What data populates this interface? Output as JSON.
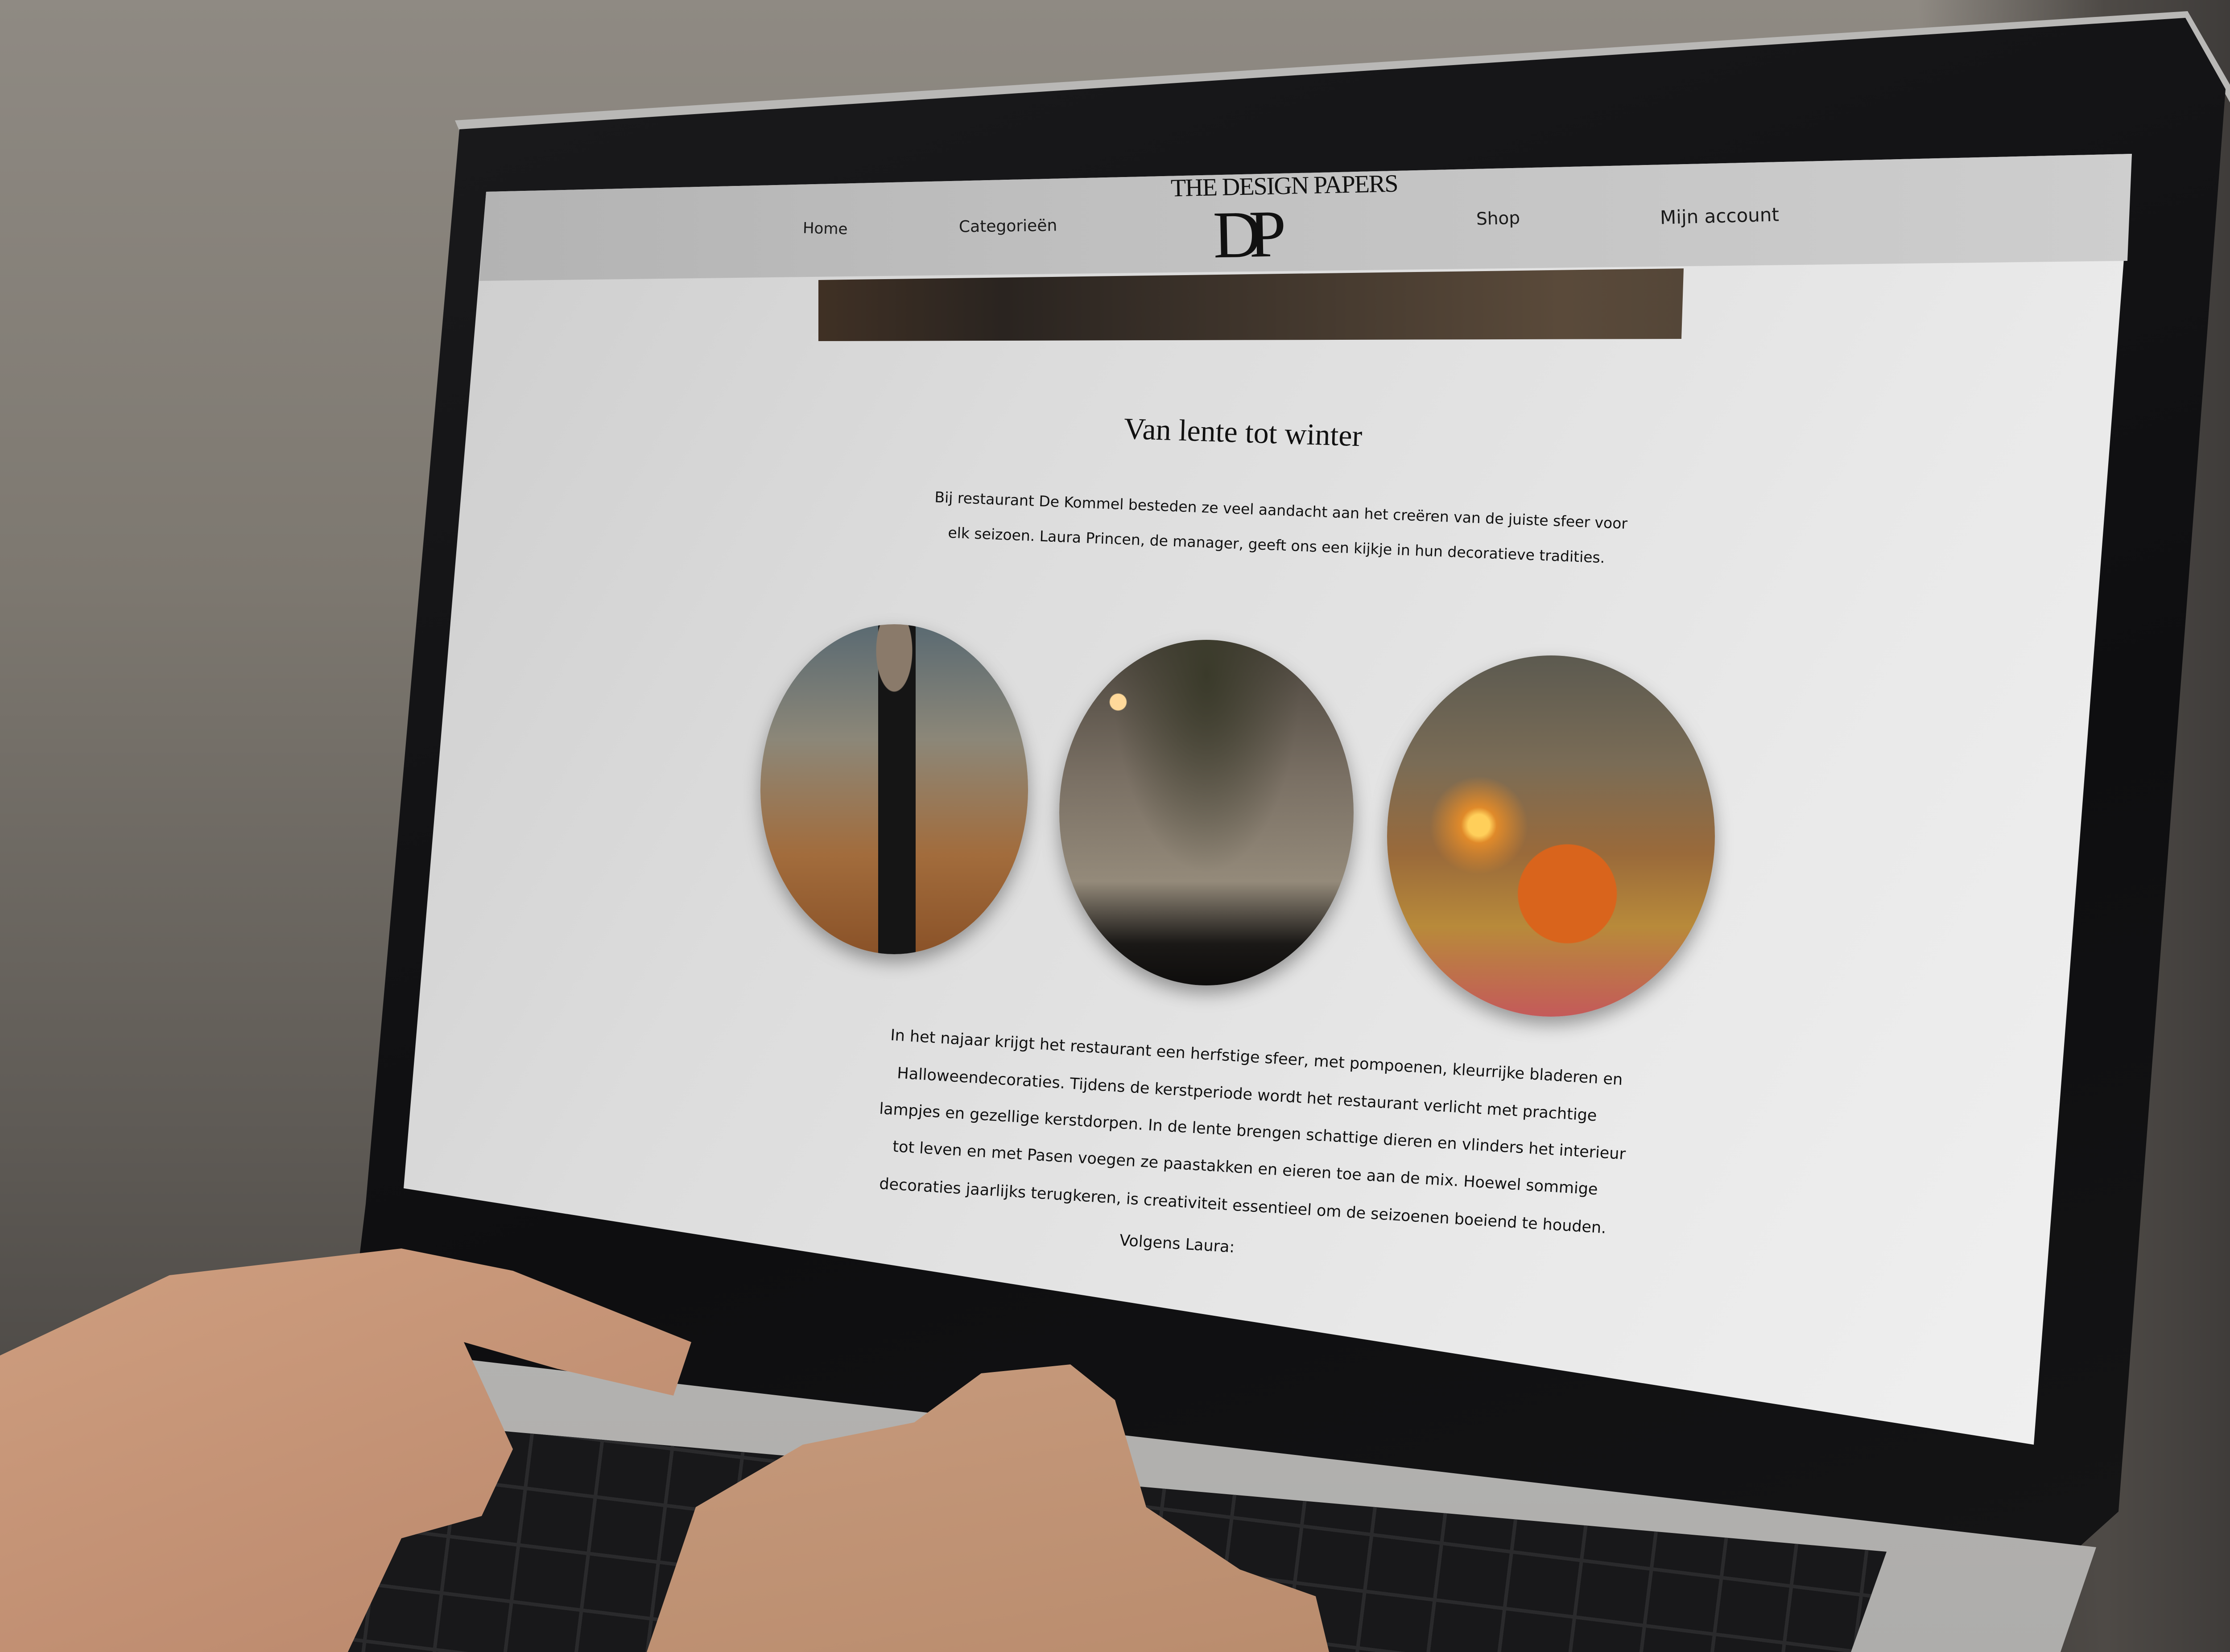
{
  "nav": {
    "home": "Home",
    "categories": "Categorieën",
    "shop": "Shop",
    "account": "Mijn account"
  },
  "logo": {
    "wordmark": "THE DESIGN PAPERS",
    "monogram": "DP"
  },
  "article": {
    "title": "Van lente tot winter",
    "intro_lines": [
      "Bij restaurant De Kommel besteden ze veel aandacht aan het creëren van de juiste sfeer voor",
      "elk seizoen. Laura Princen, de manager, geeft ons een kijkje in hun decoratieve tradities."
    ],
    "body_lines": [
      "In het najaar krijgt het restaurant een herfstige sfeer, met pompoenen, kleurrijke bladeren en",
      "Halloweendecoraties. Tijdens de kerstperiode wordt het restaurant verlicht met prachtige",
      "lampjes en gezellige kerstdorpen. In de lente brengen schattige dieren en vlinders het interieur",
      "tot leven en met Pasen voegen ze paastakken en eieren toe aan de mix. Hoewel sommige",
      "decoraties jaarlijks terugkeren, is creativiteit essentieel om de seizoenen boeiend te houden.",
      "Volgens Laura:"
    ]
  },
  "colors": {
    "navbar": "#c0c0c0",
    "page_background": "#e6e6e6",
    "text": "#111111"
  }
}
